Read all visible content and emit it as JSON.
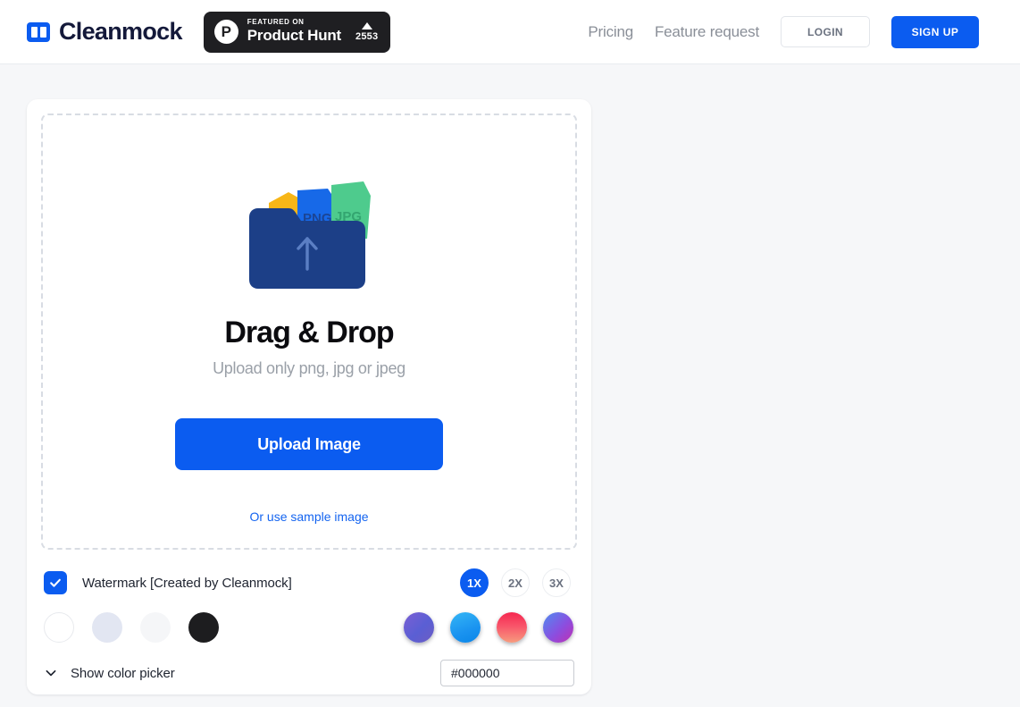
{
  "header": {
    "brand_name": "Cleanmock",
    "brand_icon": "book-logo-icon",
    "product_hunt": {
      "logo": "P",
      "kicker": "FEATURED ON",
      "title": "Product Hunt",
      "upvotes": "2553"
    },
    "nav": [
      {
        "label": "Pricing",
        "name": "nav-pricing"
      },
      {
        "label": "Feature request",
        "name": "nav-feature-request"
      }
    ],
    "login_label": "LOGIN",
    "signup_label": "SIGN UP"
  },
  "dropzone": {
    "title": "Drag & Drop",
    "subtitle": "Upload only png, jpg or jpeg",
    "upload_button": "Upload Image",
    "sample_link": "Or use sample image",
    "illustration": {
      "file_labels": [
        "PNG",
        "JPG"
      ],
      "folder_color": "#1c3f87",
      "orange_color": "#f7b617",
      "blue_color": "#1769e8",
      "green_color": "#4ecb8d",
      "arrow": "upload-arrow-icon"
    }
  },
  "options": {
    "watermark": {
      "label": "Watermark [Created by Cleanmock]",
      "checked": true
    },
    "scales": [
      {
        "label": "1X",
        "active": true
      },
      {
        "label": "2X",
        "active": false
      },
      {
        "label": "3X",
        "active": false
      }
    ],
    "solid_colors": [
      {
        "name": "swatch-white",
        "value": "#ffffff"
      },
      {
        "name": "swatch-lavender",
        "value": "#e2e6f2"
      },
      {
        "name": "swatch-light-grey",
        "value": "#f5f6f8"
      },
      {
        "name": "swatch-black",
        "value": "#1d1d1f"
      }
    ],
    "gradient_colors": [
      {
        "name": "swatch-gradient-violet",
        "value": "linear-gradient(135deg, #7b5fd4 0%, #5a5fd4 55%, #6d5cc4 100%)"
      },
      {
        "name": "swatch-gradient-sky",
        "value": "linear-gradient(160deg, #35b6f5 0%, #1a93f0 60%, #0a86e8 100%)"
      },
      {
        "name": "swatch-gradient-sunset",
        "value": "linear-gradient(180deg, #f5274f 0%, #f8546a 45%, #f79b7e 100%)"
      },
      {
        "name": "swatch-gradient-magenta",
        "value": "linear-gradient(135deg, #4f8df0 0%, #8a4fe0 55%, #c02fb4 100%)"
      }
    ],
    "color_picker": {
      "toggle_label": "Show color picker",
      "chevron": "chevron-down-icon",
      "hex_value": "#000000",
      "hex_placeholder": "#000000"
    }
  },
  "theme": {
    "accent": "#0b5cf0",
    "page_bg": "#f6f7f9",
    "card_bg": "#ffffff",
    "muted_text": "#9aa0a8"
  }
}
